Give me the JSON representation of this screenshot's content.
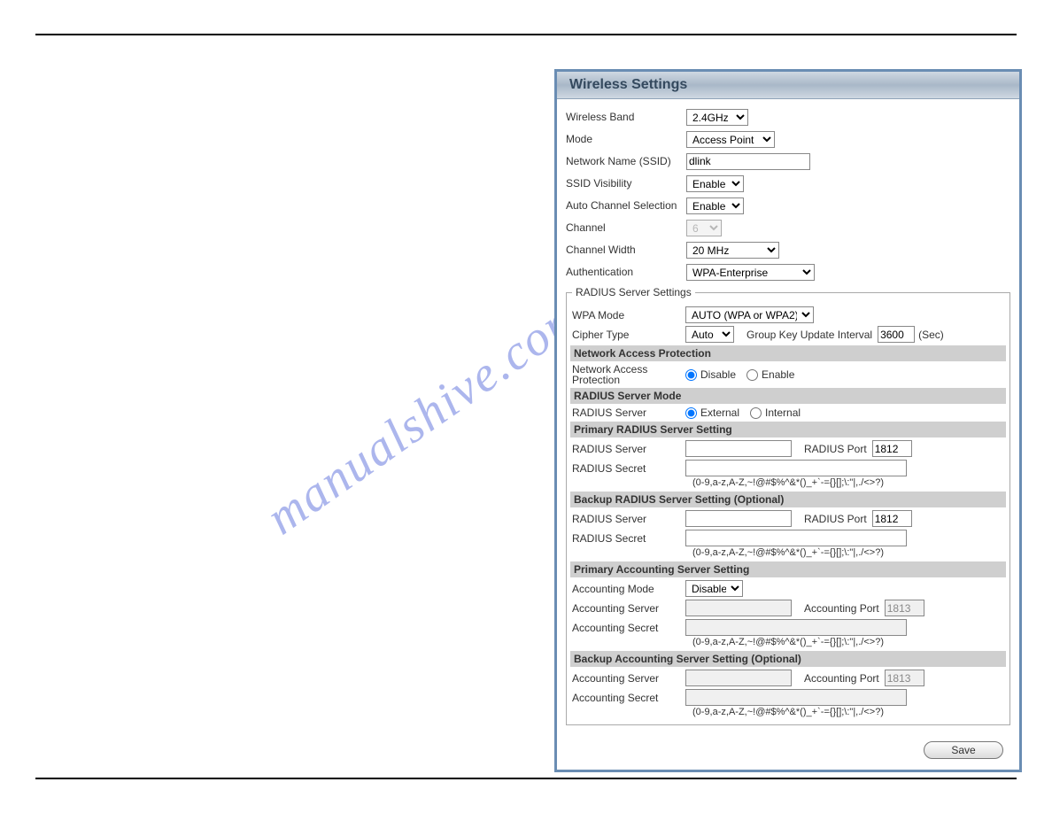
{
  "watermark": "manualshive.com",
  "header": {
    "title": "Wireless Settings"
  },
  "top": {
    "band_label": "Wireless Band",
    "band_value": "2.4GHz",
    "mode_label": "Mode",
    "mode_value": "Access Point",
    "ssid_label": "Network Name (SSID)",
    "ssid_value": "dlink",
    "vis_label": "SSID Visibility",
    "vis_value": "Enable",
    "auto_label": "Auto Channel Selection",
    "auto_value": "Enable",
    "channel_label": "Channel",
    "channel_value": "6",
    "width_label": "Channel Width",
    "width_value": "20 MHz",
    "auth_label": "Authentication",
    "auth_value": "WPA-Enterprise"
  },
  "radius": {
    "legend": "RADIUS Server Settings",
    "wpa_mode_label": "WPA Mode",
    "wpa_mode_value": "AUTO (WPA or WPA2)",
    "cipher_label": "Cipher Type",
    "cipher_value": "Auto",
    "gkui_label": "Group Key Update Interval",
    "gkui_value": "3600",
    "gkui_unit": "(Sec)",
    "nap_header": "Network Access Protection",
    "nap_label": "Network Access Protection",
    "disable": "Disable",
    "enable": "Enable",
    "rsm_header": "RADIUS Server Mode",
    "rsm_label": "RADIUS Server",
    "external": "External",
    "internal": "Internal",
    "primary_header": "Primary RADIUS Server Setting",
    "radius_server_label": "RADIUS Server",
    "radius_port_label": "RADIUS Port",
    "radius_secret_label": "RADIUS Secret",
    "primary_port": "1812",
    "hint": "(0-9,a-z,A-Z,~!@#$%^&*()_+`-={}[];\\:\"|,./<>?)",
    "backup_header": "Backup RADIUS Server Setting (Optional)",
    "backup_port": "1812",
    "acct_primary_header": "Primary Accounting Server Setting",
    "acct_mode_label": "Accounting Mode",
    "acct_mode_value": "Disable",
    "acct_server_label": "Accounting Server",
    "acct_port_label": "Accounting Port",
    "acct_secret_label": "Accounting Secret",
    "acct_primary_port": "1813",
    "acct_backup_header": "Backup Accounting Server Setting (Optional)",
    "acct_backup_port": "1813"
  },
  "buttons": {
    "save": "Save"
  }
}
